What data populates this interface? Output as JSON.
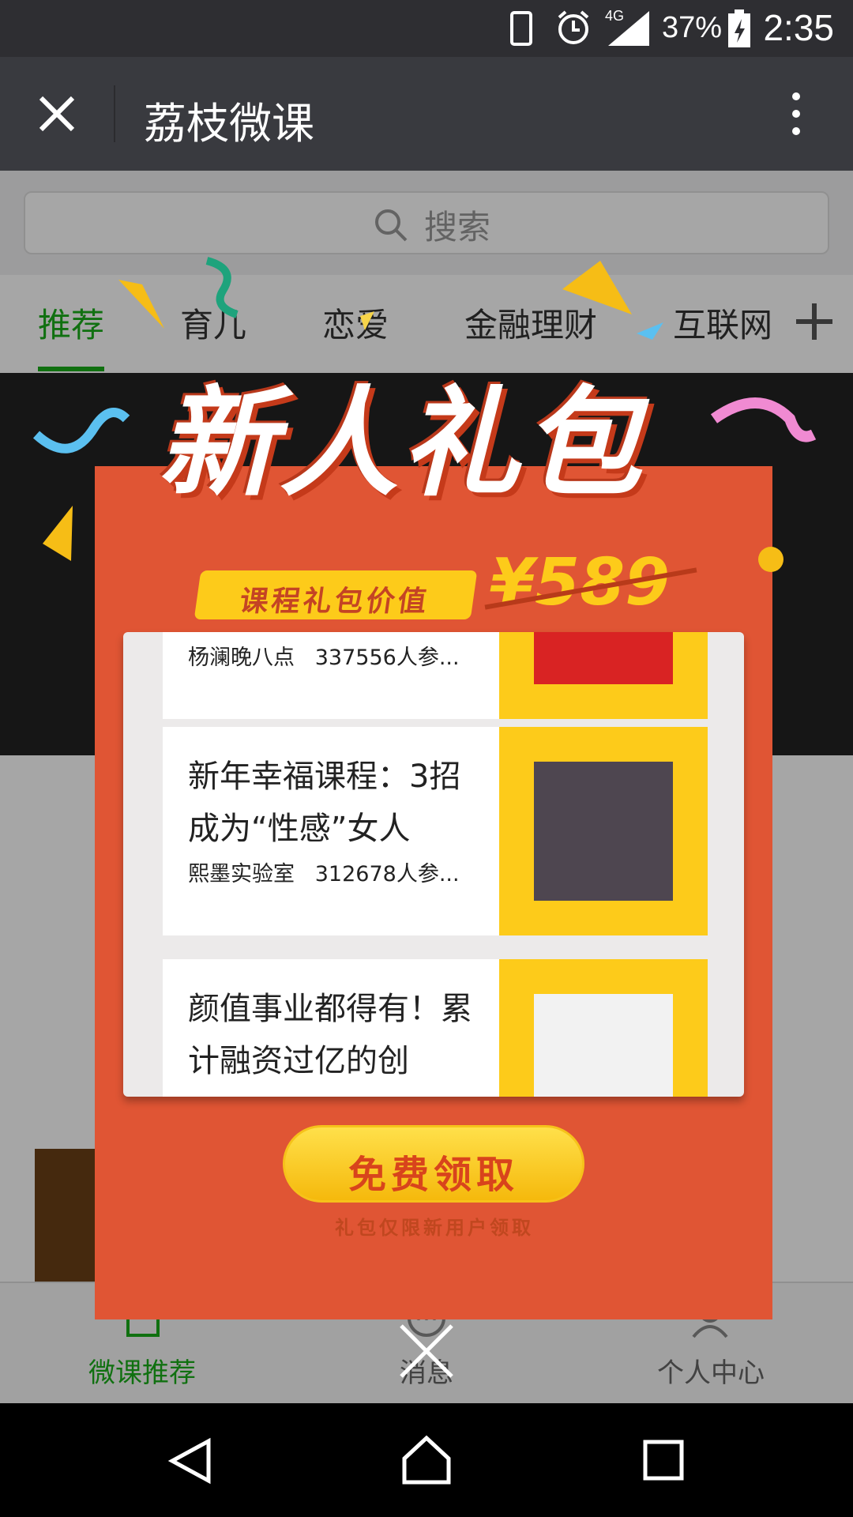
{
  "status_bar": {
    "network": "4G",
    "battery": "37%",
    "time": "2:35"
  },
  "title_bar": {
    "title": "荔枝微课"
  },
  "search": {
    "placeholder": "搜索"
  },
  "tabs": [
    {
      "label": "推荐"
    },
    {
      "label": "育儿"
    },
    {
      "label": "恋爱"
    },
    {
      "label": "金融理财"
    },
    {
      "label": "互联网"
    }
  ],
  "bottom_nav": [
    {
      "label": "微课推荐"
    },
    {
      "label": "消息"
    },
    {
      "label": "个人中心"
    }
  ],
  "popup": {
    "title": "新人礼包",
    "value_label": "课程礼包价值",
    "price": "¥589",
    "courses": [
      {
        "name": "",
        "author": "杨澜晚八点",
        "participants": "337556人参..."
      },
      {
        "name": "新年幸福课程：3招成为“性感”女人",
        "author": "熙墨实验室",
        "participants": "312678人参..."
      },
      {
        "name": "颜值事业都得有！累计融资过亿的创",
        "author": "",
        "participants": ""
      }
    ],
    "claim_button": "免费领取",
    "note": "礼包仅限新用户领取"
  },
  "colors": {
    "accent": "#1aad19",
    "popup_red": "#e05534",
    "gold": "#fdcb1a"
  }
}
